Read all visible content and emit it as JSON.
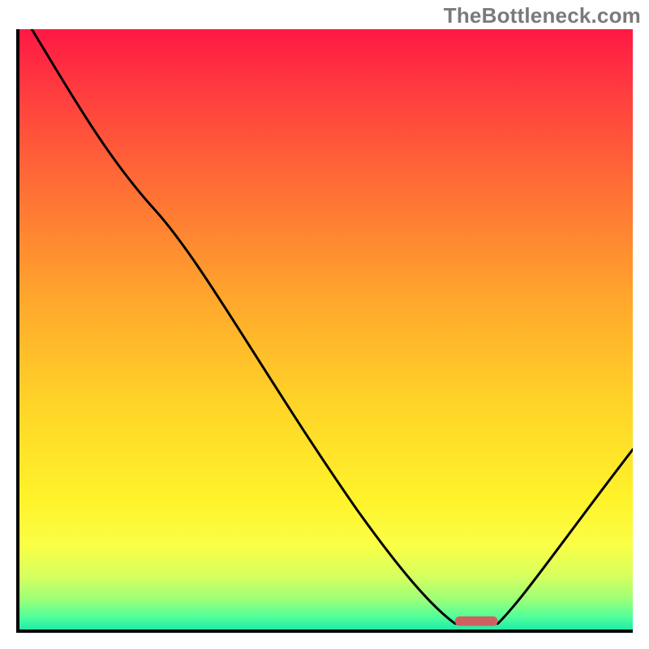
{
  "watermark": "TheBottleneck.com",
  "chart_data": {
    "type": "line",
    "title": "",
    "xlabel": "",
    "ylabel": "",
    "xlim": [
      0,
      100
    ],
    "ylim": [
      0,
      100
    ],
    "grid": false,
    "legend": false,
    "gradient_stops": [
      {
        "pos": 0,
        "color": "#ff1844"
      },
      {
        "pos": 10,
        "color": "#ff3b3f"
      },
      {
        "pos": 25,
        "color": "#ff6a36"
      },
      {
        "pos": 45,
        "color": "#ffa72c"
      },
      {
        "pos": 62,
        "color": "#ffd328"
      },
      {
        "pos": 78,
        "color": "#fff22a"
      },
      {
        "pos": 86,
        "color": "#faff46"
      },
      {
        "pos": 91,
        "color": "#d7ff5e"
      },
      {
        "pos": 95,
        "color": "#9cff78"
      },
      {
        "pos": 98,
        "color": "#4dff9c"
      },
      {
        "pos": 100,
        "color": "#22eaa8"
      }
    ],
    "series": [
      {
        "name": "bottleneck-curve",
        "color": "#000000",
        "stroke_width": 3,
        "points": [
          {
            "x": 2,
            "y": 100
          },
          {
            "x": 12,
            "y": 85
          },
          {
            "x": 22,
            "y": 70
          },
          {
            "x": 40,
            "y": 42
          },
          {
            "x": 55,
            "y": 20
          },
          {
            "x": 66,
            "y": 6
          },
          {
            "x": 71,
            "y": 1
          },
          {
            "x": 78,
            "y": 1
          },
          {
            "x": 82,
            "y": 5
          },
          {
            "x": 100,
            "y": 30
          }
        ]
      }
    ],
    "marker": {
      "name": "optimal-range",
      "color": "#d06060",
      "x_start": 71,
      "x_end": 78,
      "y": 1,
      "height": 2
    }
  }
}
